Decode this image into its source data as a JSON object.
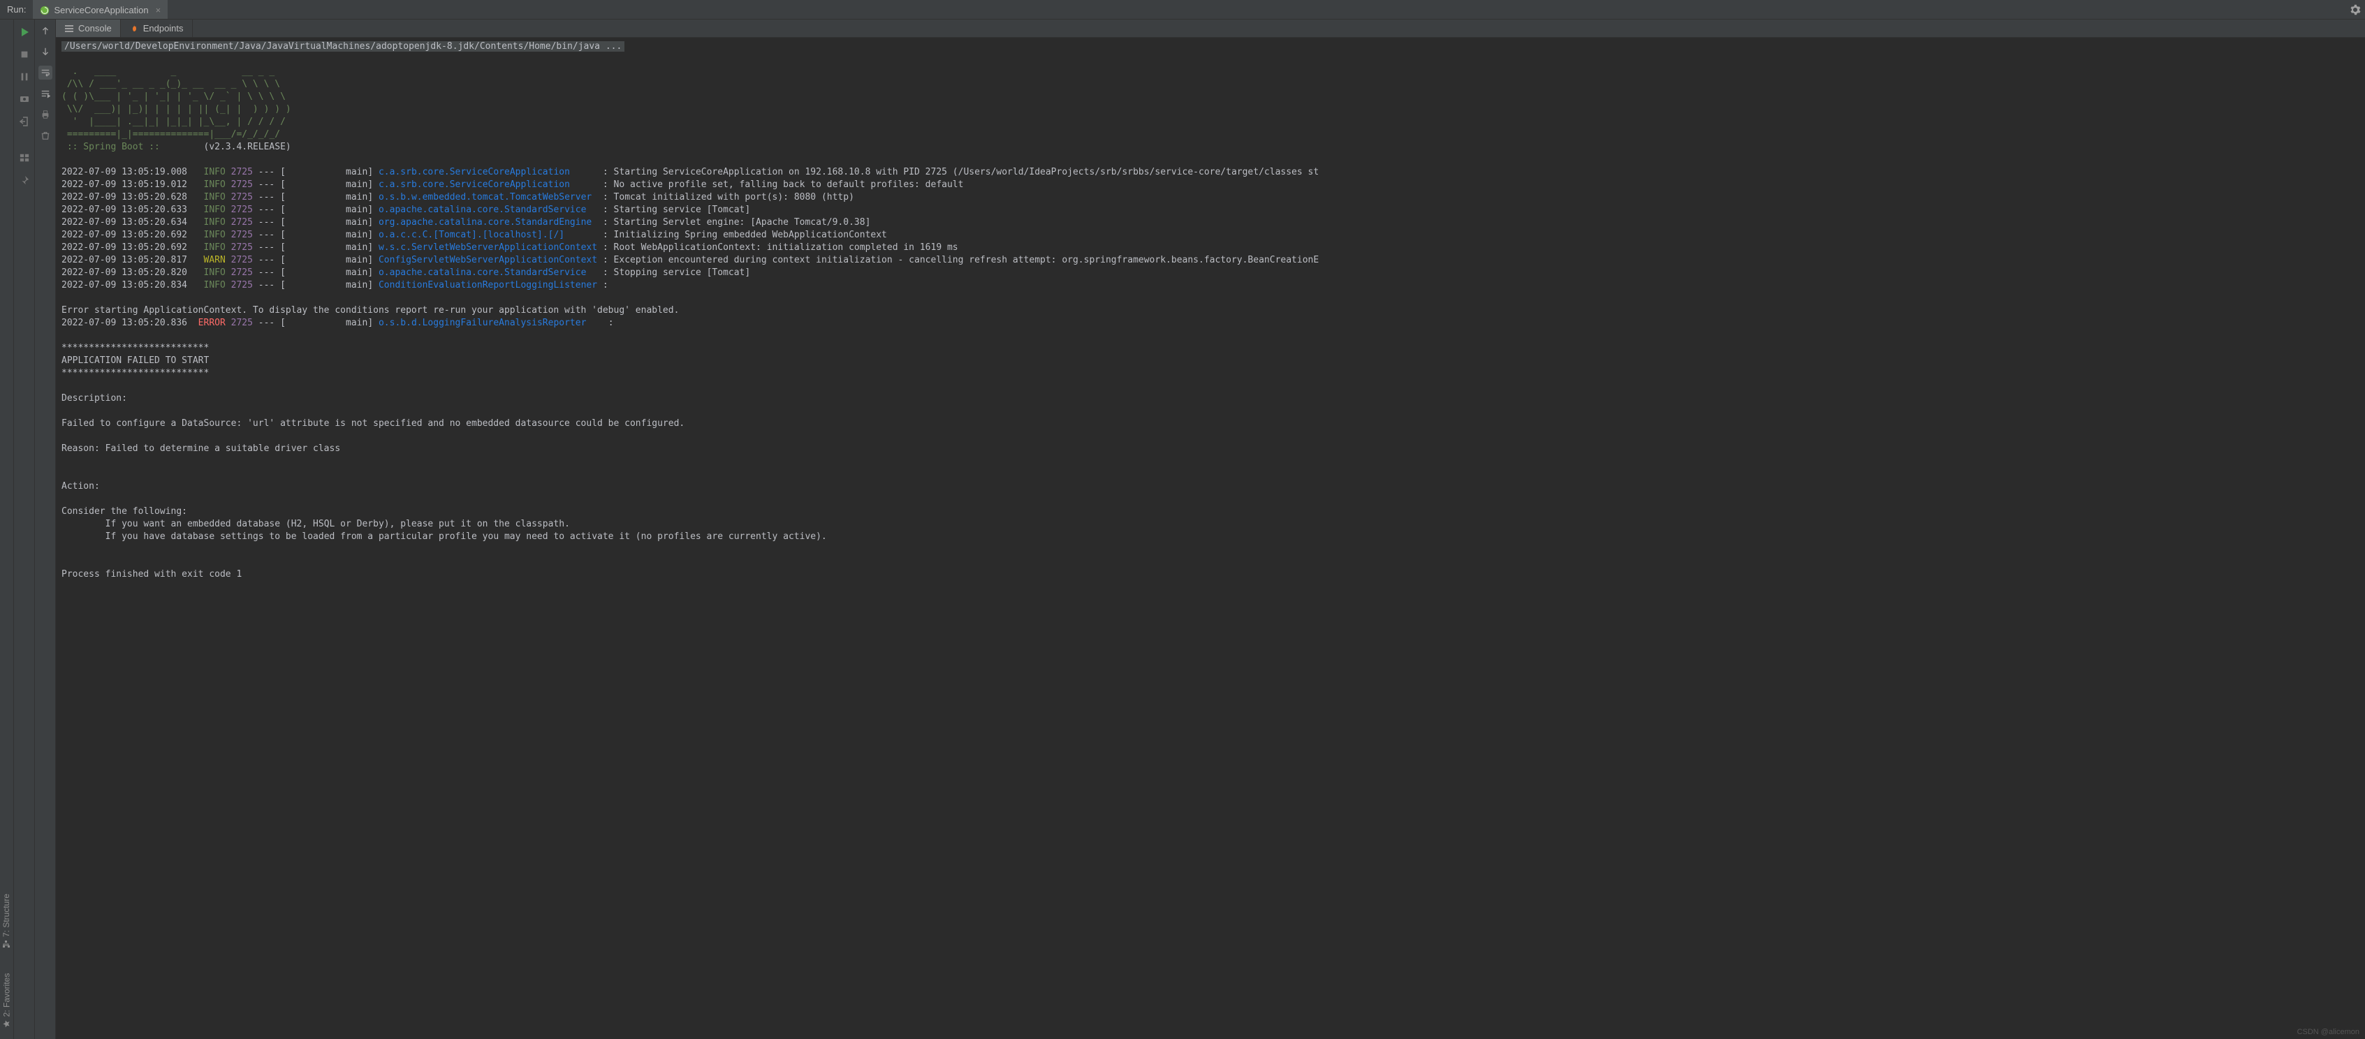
{
  "runbar": {
    "label": "Run:",
    "tab": {
      "title": "ServiceCoreApplication"
    }
  },
  "tabs": {
    "console": "Console",
    "endpoints": "Endpoints"
  },
  "sidebar": {
    "structure": "7: Structure",
    "favorites": "2: Favorites"
  },
  "cmdline": "/Users/world/DevelopEnvironment/Java/JavaVirtualMachines/adoptopenjdk-8.jdk/Contents/Home/bin/java ...",
  "banner": {
    "l1": "  .   ____          _            __ _ _",
    "l2": " /\\\\ / ___'_ __ _ _(_)_ __  __ _ \\ \\ \\ \\",
    "l3": "( ( )\\___ | '_ | '_| | '_ \\/ _` | \\ \\ \\ \\",
    "l4": " \\\\/  ___)| |_)| | | | | || (_| |  ) ) ) )",
    "l5": "  '  |____| .__|_| |_|_| |_\\__, | / / / /",
    "l6": " =========|_|==============|___/=/_/_/_/",
    "boot": " :: Spring Boot :: ",
    "ver": "       (v2.3.4.RELEASE)"
  },
  "logs": [
    {
      "ts": "2022-07-09 13:05:19.008",
      "lvl": "INFO",
      "pid": "2725",
      "sep": "--- [",
      "thread": "           main] ",
      "logger": "c.a.srb.core.ServiceCoreApplication     ",
      "msg": " : Starting ServiceCoreApplication on 192.168.10.8 with PID 2725 (/Users/world/IdeaProjects/srb/srbbs/service-core/target/classes st"
    },
    {
      "ts": "2022-07-09 13:05:19.012",
      "lvl": "INFO",
      "pid": "2725",
      "sep": "--- [",
      "thread": "           main] ",
      "logger": "c.a.srb.core.ServiceCoreApplication     ",
      "msg": " : No active profile set, falling back to default profiles: default"
    },
    {
      "ts": "2022-07-09 13:05:20.628",
      "lvl": "INFO",
      "pid": "2725",
      "sep": "--- [",
      "thread": "           main] ",
      "logger": "o.s.b.w.embedded.tomcat.TomcatWebServer ",
      "msg": " : Tomcat initialized with port(s): 8080 (http)"
    },
    {
      "ts": "2022-07-09 13:05:20.633",
      "lvl": "INFO",
      "pid": "2725",
      "sep": "--- [",
      "thread": "           main] ",
      "logger": "o.apache.catalina.core.StandardService  ",
      "msg": " : Starting service [Tomcat]"
    },
    {
      "ts": "2022-07-09 13:05:20.634",
      "lvl": "INFO",
      "pid": "2725",
      "sep": "--- [",
      "thread": "           main] ",
      "logger": "org.apache.catalina.core.StandardEngine ",
      "msg": " : Starting Servlet engine: [Apache Tomcat/9.0.38]"
    },
    {
      "ts": "2022-07-09 13:05:20.692",
      "lvl": "INFO",
      "pid": "2725",
      "sep": "--- [",
      "thread": "           main] ",
      "logger": "o.a.c.c.C.[Tomcat].[localhost].[/]      ",
      "msg": " : Initializing Spring embedded WebApplicationContext"
    },
    {
      "ts": "2022-07-09 13:05:20.692",
      "lvl": "INFO",
      "pid": "2725",
      "sep": "--- [",
      "thread": "           main] ",
      "logger": "w.s.c.ServletWebServerApplicationContext",
      "msg": " : Root WebApplicationContext: initialization completed in 1619 ms"
    },
    {
      "ts": "2022-07-09 13:05:20.817",
      "lvl": "WARN",
      "pid": "2725",
      "sep": "--- [",
      "thread": "           main] ",
      "logger": "ConfigServletWebServerApplicationContext",
      "msg": " : Exception encountered during context initialization - cancelling refresh attempt: org.springframework.beans.factory.BeanCreationE"
    },
    {
      "ts": "2022-07-09 13:05:20.820",
      "lvl": "INFO",
      "pid": "2725",
      "sep": "--- [",
      "thread": "           main] ",
      "logger": "o.apache.catalina.core.StandardService  ",
      "msg": " : Stopping service [Tomcat]"
    },
    {
      "ts": "2022-07-09 13:05:20.834",
      "lvl": "INFO",
      "pid": "2725",
      "sep": "--- [",
      "thread": "           main] ",
      "logger": "ConditionEvaluationReportLoggingListener",
      "msg": " :"
    }
  ],
  "err_hint": "Error starting ApplicationContext. To display the conditions report re-run your application with 'debug' enabled.",
  "err_log": {
    "ts": "2022-07-09 13:05:20.836",
    "lvl": "ERROR",
    "pid": "2725",
    "sep": "--- [",
    "thread": "           main] ",
    "logger": "o.s.b.d.LoggingFailureAnalysisReporter  ",
    "msg": "  :"
  },
  "fail": {
    "bar": "***************************",
    "title": "APPLICATION FAILED TO START",
    "desc_h": "Description:",
    "desc": "Failed to configure a DataSource: 'url' attribute is not specified and no embedded datasource could be configured.",
    "reason": "Reason: Failed to determine a suitable driver class",
    "action_h": "Action:",
    "consider": "Consider the following:",
    "c1": "\tIf you want an embedded database (H2, HSQL or Derby), please put it on the classpath.",
    "c2": "\tIf you have database settings to be loaded from a particular profile you may need to activate it (no profiles are currently active).",
    "exit": "Process finished with exit code 1"
  },
  "watermark": "CSDN @alicemon"
}
